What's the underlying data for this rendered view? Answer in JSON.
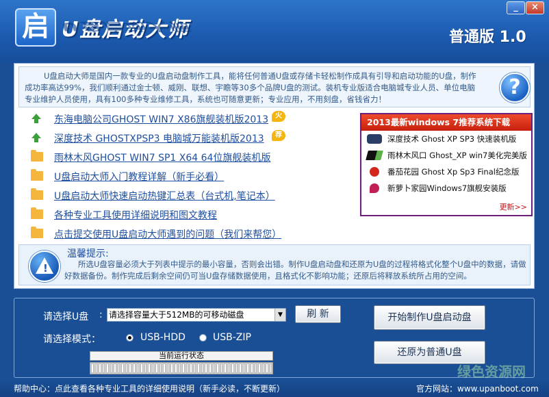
{
  "window": {
    "title": "U盘启动大师",
    "logo_char": "启",
    "version": "普通版 1.0",
    "min_label": "_",
    "close_label": "×"
  },
  "intro": {
    "text": "U盘启动大师是国内一款专业的U盘启动盘制作工具，能将任何普通U盘或存储卡轻松制作成具有引导和启动功能的U盘，制作成功率高达99%，我们顺利通过金士顿、威刚、联想、宇瞻等30多个品牌U盘的测试。装机专业版适合电脑城专业人员、单位电脑专业维护人员使用，具有100多种专业维修工具，系统也可随意更新；专业应用，不用刻盘，省钱省力！",
    "help_symbol": "?"
  },
  "links": [
    {
      "text": "东海电脑公司GHOST WIN7 X86旗舰装机版2013",
      "badge": "火"
    },
    {
      "text": "深度技术 GHOSTXPSP3 电脑城万能装机版2013",
      "badge": "荐"
    },
    {
      "text": "雨林木风GHOST WIN7 SP1 X64 64位旗舰装机版"
    },
    {
      "text": "U盘启动大师入门教程详解（新手必看）"
    },
    {
      "text": "U盘启动大师快速启动热键汇总表（台式机,笔记本）"
    },
    {
      "text": "各种专业工具使用详细说明和图文教程"
    },
    {
      "text": "点击提交使用U盘启动大师遇到的问题（我们来帮您）"
    }
  ],
  "recommend": {
    "title": "2013最新windows 7推荐系统下载",
    "items": [
      "深度技术 Ghost XP SP3 快速装机版",
      "雨林木风口 Ghost_XP win7美化完美版",
      "番茄花园 Ghost Xp Sp3 Final纪念版",
      "新萝卜家园Windows7旗舰安装版"
    ],
    "more": "更新>>"
  },
  "tips": {
    "title": "温馨提示:",
    "text": "所选U盘容量必须大于列表中提示的最小容量，否则会出错。制作U盘启动盘和还原为U盘的过程将格式化整个U盘中的数据，请做好数据备份。制作完成后剩余空间仍可当U盘存储数据使用，且格式化不影响功能；还原后将释放系统所占用的空间。",
    "icon_symbol": "!"
  },
  "controls": {
    "select_usb_label": "请选择U盘",
    "colon": ":",
    "select_value": "请选择容量大于512MB的可移动磁盘",
    "refresh_label": "刷 新",
    "mode_label": "请选择模式：",
    "mode_options": [
      "USB-HDD",
      "USB-ZIP"
    ],
    "selected_mode": "USB-HDD",
    "status_label": "当前运行状态",
    "make_label": "开始制作U盘启动盘",
    "restore_label": "还原为普通U盘",
    "progress_percent": 0
  },
  "footer": {
    "help": "帮助中心：点此查看各种专业工具的详细使用说明（新手必读，不断更新）",
    "site": "官方网站：www.upanboot.com"
  },
  "watermark": "绿色资源网",
  "colors": {
    "frame_blue": "#1a4f96",
    "link_blue": "#1f4f9f",
    "recommend_red": "#c8200e"
  }
}
